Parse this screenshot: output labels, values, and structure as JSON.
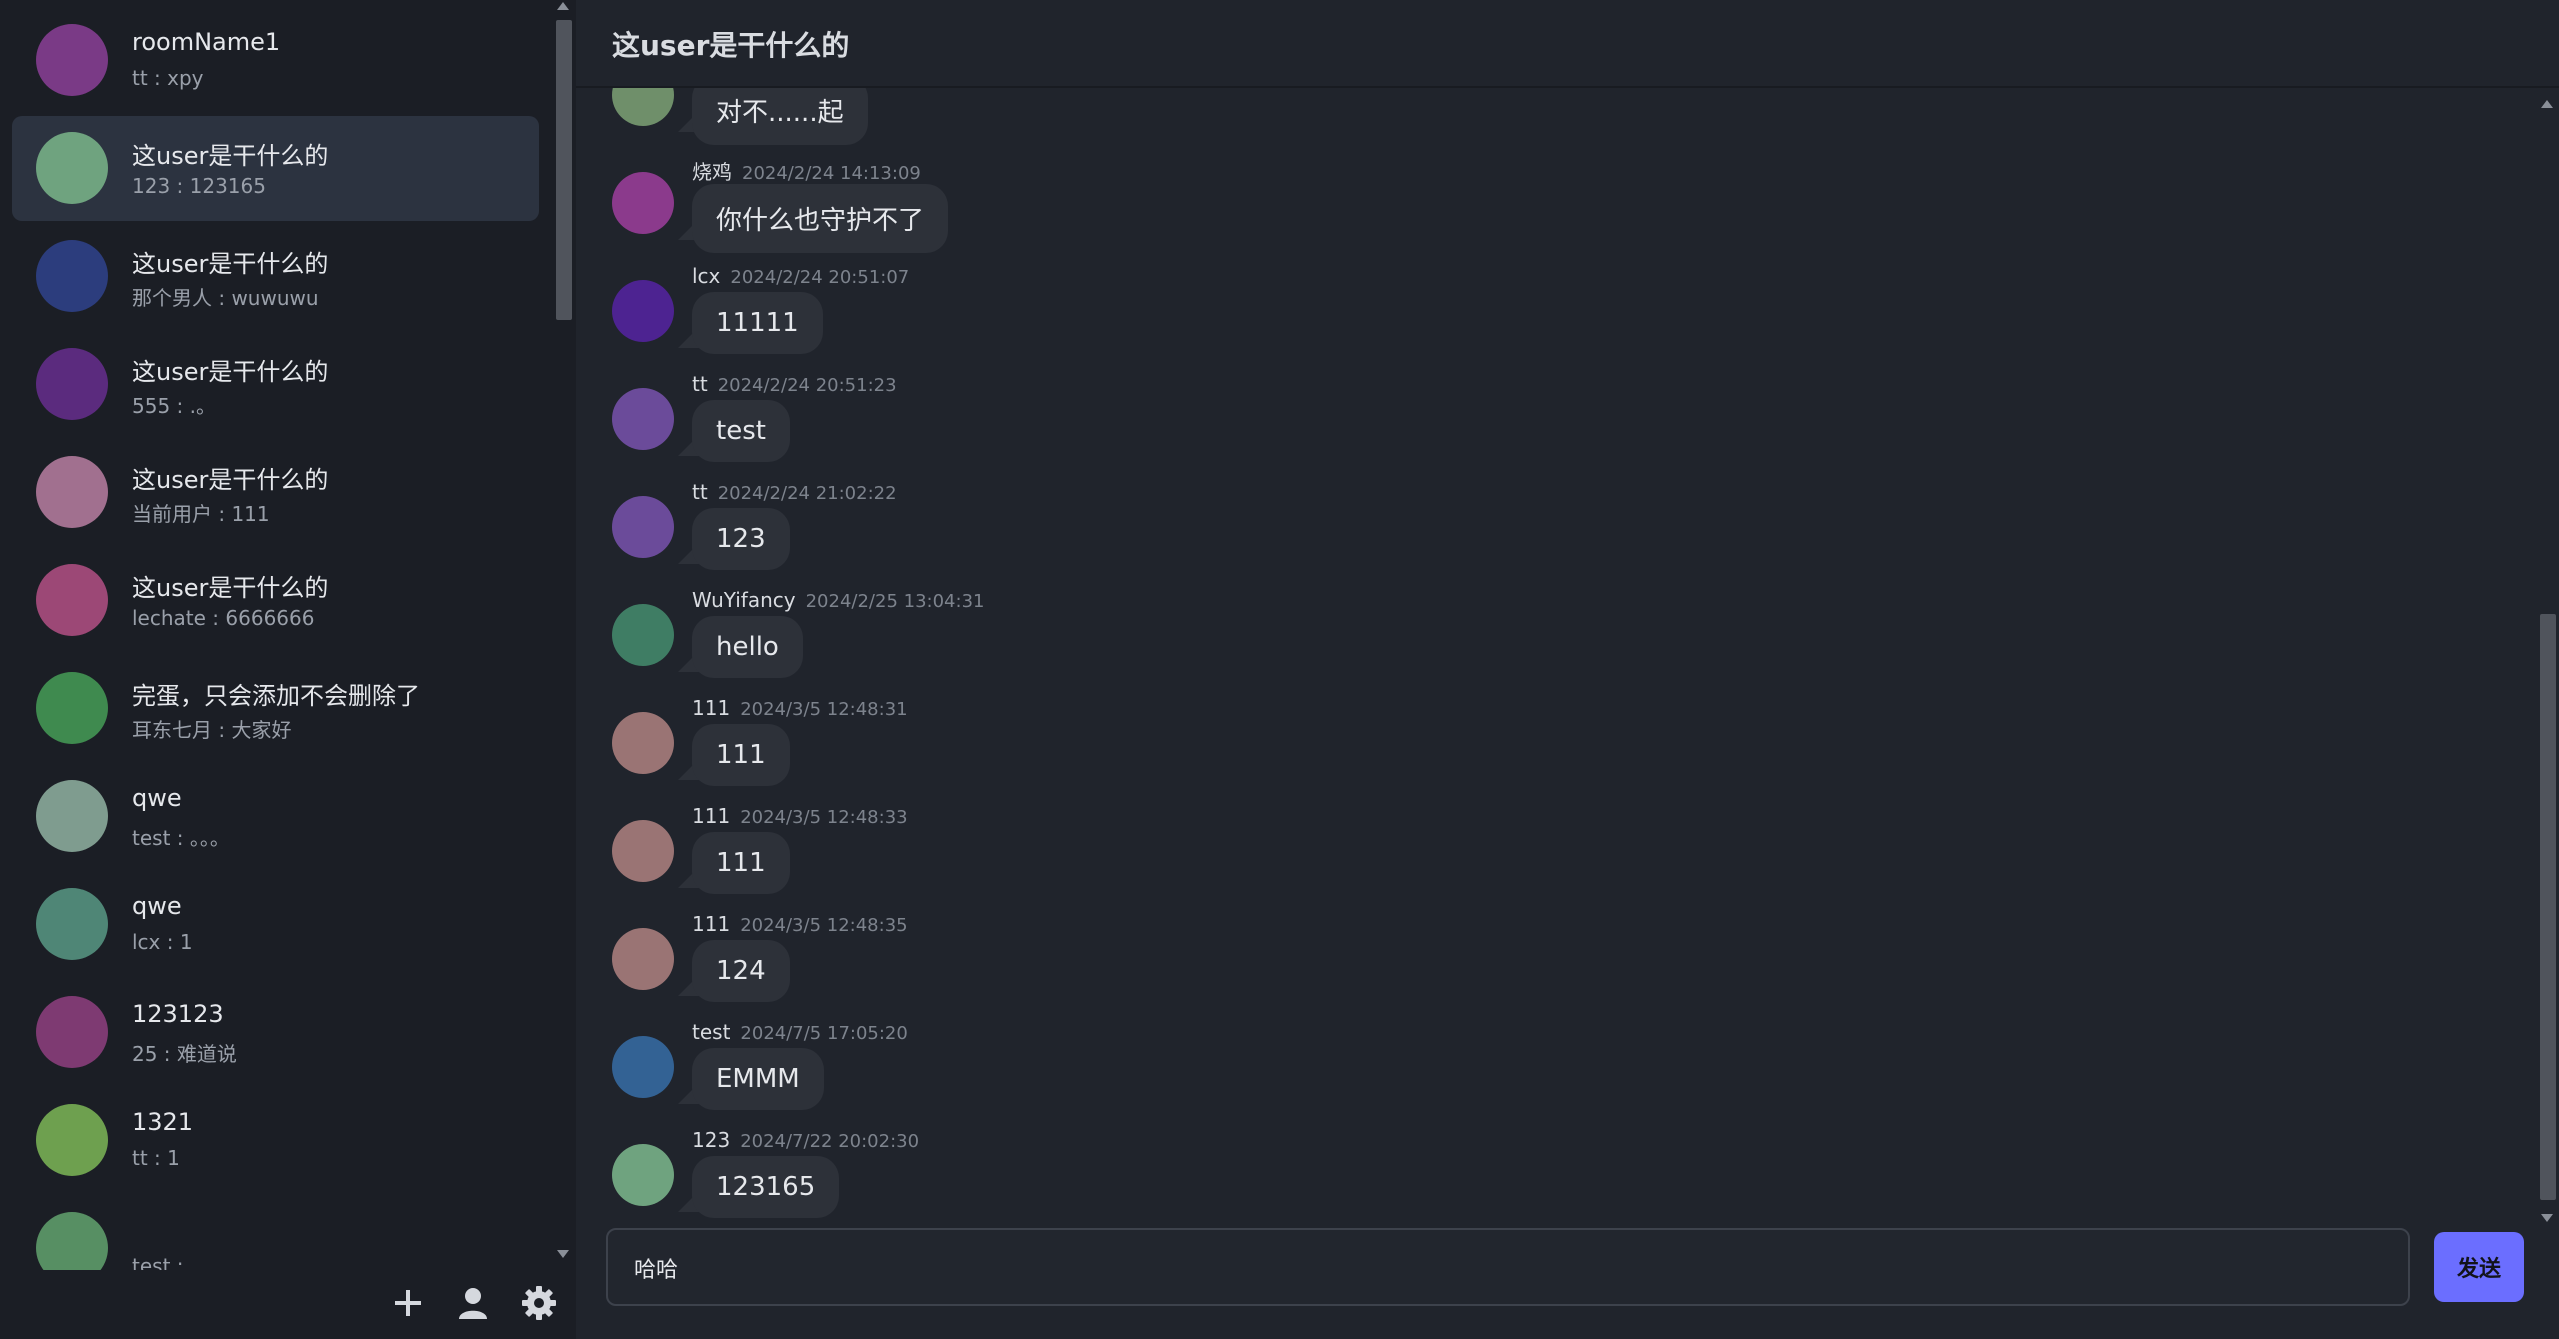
{
  "sidebar": {
    "rooms": [
      {
        "name": "roomName1",
        "last": "tt : xpy",
        "avatar_color": "#7a3a86",
        "active": false
      },
      {
        "name": "这user是干什么的",
        "last": "123 : 123165",
        "avatar_color": "#6fa37f",
        "active": true
      },
      {
        "name": "这user是干什么的",
        "last": "那个男人 : wuwuwu",
        "avatar_color": "#2c3d7d",
        "active": false
      },
      {
        "name": "这user是干什么的",
        "last": "555 : .。",
        "avatar_color": "#5b2b7e",
        "active": false
      },
      {
        "name": "这user是干什么的",
        "last": "当前用户 : 111",
        "avatar_color": "#a1708f",
        "active": false
      },
      {
        "name": "这user是干什么的",
        "last": "lechate : 6666666",
        "avatar_color": "#9c4876",
        "active": false
      },
      {
        "name": "完蛋，只会添加不会删除了",
        "last": "耳东七月 : 大家好",
        "avatar_color": "#3f8a4f",
        "active": false
      },
      {
        "name": "qwe",
        "last": "test : 。。。",
        "avatar_color": "#7f9c8f",
        "active": false
      },
      {
        "name": "qwe",
        "last": "lcx : 1",
        "avatar_color": "#4f8676",
        "active": false
      },
      {
        "name": "123123",
        "last": "25 : 难道说",
        "avatar_color": "#7e3a72",
        "active": false
      },
      {
        "name": "1321",
        "last": "tt : 1",
        "avatar_color": "#6ea04f",
        "active": false
      },
      {
        "name": "",
        "last": "test :",
        "avatar_color": "#578f63",
        "active": false
      }
    ],
    "tools": [
      {
        "icon": "plus-icon"
      },
      {
        "icon": "user-icon"
      },
      {
        "icon": "gear-icon"
      }
    ]
  },
  "chat": {
    "title": "这user是干什么的",
    "messages": [
      {
        "sender": "",
        "time": "",
        "text": "对不......起",
        "avatar_color": "#6f8f6a"
      },
      {
        "sender": "烧鸡",
        "time": "2024/2/24 14:13:09",
        "text": "你什么也守护不了",
        "avatar_color": "#8b3a8c"
      },
      {
        "sender": "lcx",
        "time": "2024/2/24 20:51:07",
        "text": "11111",
        "avatar_color": "#4d2391"
      },
      {
        "sender": "tt",
        "time": "2024/2/24 20:51:23",
        "text": "test",
        "avatar_color": "#6b4b9a"
      },
      {
        "sender": "tt",
        "time": "2024/2/24 21:02:22",
        "text": "123",
        "avatar_color": "#6b4b9a"
      },
      {
        "sender": "WuYifancy",
        "time": "2024/2/25 13:04:31",
        "text": "hello",
        "avatar_color": "#3f7d64"
      },
      {
        "sender": "111",
        "time": "2024/3/5 12:48:31",
        "text": "111",
        "avatar_color": "#9a7474"
      },
      {
        "sender": "111",
        "time": "2024/3/5 12:48:33",
        "text": "111",
        "avatar_color": "#9a7474"
      },
      {
        "sender": "111",
        "time": "2024/3/5 12:48:35",
        "text": "124",
        "avatar_color": "#9a7474"
      },
      {
        "sender": "test",
        "time": "2024/7/5 17:05:20",
        "text": "EMMM",
        "avatar_color": "#336294"
      },
      {
        "sender": "123",
        "time": "2024/7/22 20:02:30",
        "text": "123165",
        "avatar_color": "#6fa37f"
      }
    ],
    "composer": {
      "value": "哈哈",
      "send_label": "发送"
    }
  }
}
